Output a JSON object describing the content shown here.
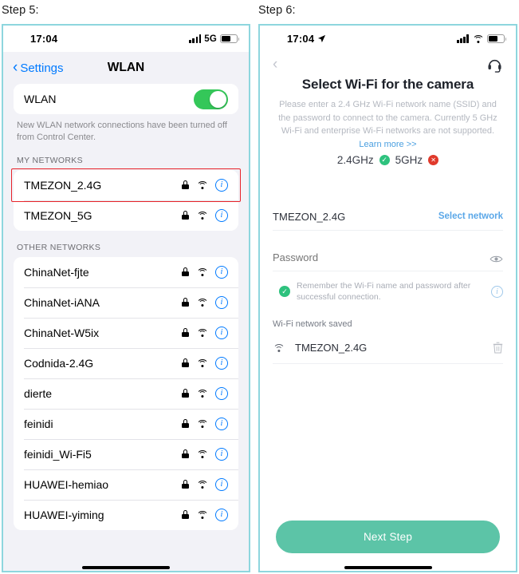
{
  "captions": {
    "step5": "Step 5:",
    "step6": "Step 6:"
  },
  "left_phone": {
    "status": {
      "time": "17:04",
      "network_label": "5G"
    },
    "nav": {
      "back_label": "Settings",
      "title": "WLAN"
    },
    "wlan_toggle": {
      "label": "WLAN",
      "state": "on"
    },
    "footnote": "New WLAN network connections have been turned off from Control Center.",
    "my_networks": {
      "header": "MY NETWORKS",
      "items": [
        {
          "name": "TMEZON_2.4G",
          "secured": true,
          "highlighted": true
        },
        {
          "name": "TMEZON_5G",
          "secured": true,
          "highlighted": false
        }
      ]
    },
    "other_networks": {
      "header": "OTHER NETWORKS",
      "items": [
        {
          "name": "ChinaNet-fjte",
          "secured": true
        },
        {
          "name": "ChinaNet-iANA",
          "secured": true
        },
        {
          "name": "ChinaNet-W5ix",
          "secured": true
        },
        {
          "name": "Codnida-2.4G",
          "secured": true
        },
        {
          "name": "dierte",
          "secured": true
        },
        {
          "name": "feinidi",
          "secured": true
        },
        {
          "name": "feinidi_Wi-Fi5",
          "secured": true
        },
        {
          "name": "HUAWEI-hemiao",
          "secured": true
        },
        {
          "name": "HUAWEI-yiming",
          "secured": true
        }
      ]
    }
  },
  "right_phone": {
    "status": {
      "time": "17:04"
    },
    "title": "Select Wi-Fi for the camera",
    "description_part1": "Please enter a 2.4 GHz Wi-Fi network name (SSID) and the password to connect to the camera. Currently 5 GHz Wi-Fi and enterprise Wi-Fi networks are not supported. ",
    "learn_more": "Learn more >>",
    "frequency": {
      "supported_label": "2.4GHz",
      "supported_mark": "✓",
      "unsupported_label": "5GHz",
      "unsupported_mark": "✕"
    },
    "ssid_field": {
      "value": "TMEZON_2.4G",
      "select_network_label": "Select network"
    },
    "password_field": {
      "placeholder": "Password",
      "value": ""
    },
    "remember": {
      "checked_mark": "✓",
      "text": "Remember the Wi-Fi name and password after successful connection."
    },
    "saved": {
      "header": "Wi-Fi network saved",
      "items": [
        {
          "name": "TMEZON_2.4G"
        }
      ]
    },
    "next_button": "Next Step"
  },
  "colors": {
    "frame_border": "#8ed6de",
    "ios_blue": "#007aff",
    "ios_green": "#34c759",
    "highlight_red": "#e8232a",
    "teal_button": "#5cc4a7",
    "link_blue": "#5aa7e8",
    "ok_green": "#2ec27e",
    "no_red": "#e0392b"
  }
}
